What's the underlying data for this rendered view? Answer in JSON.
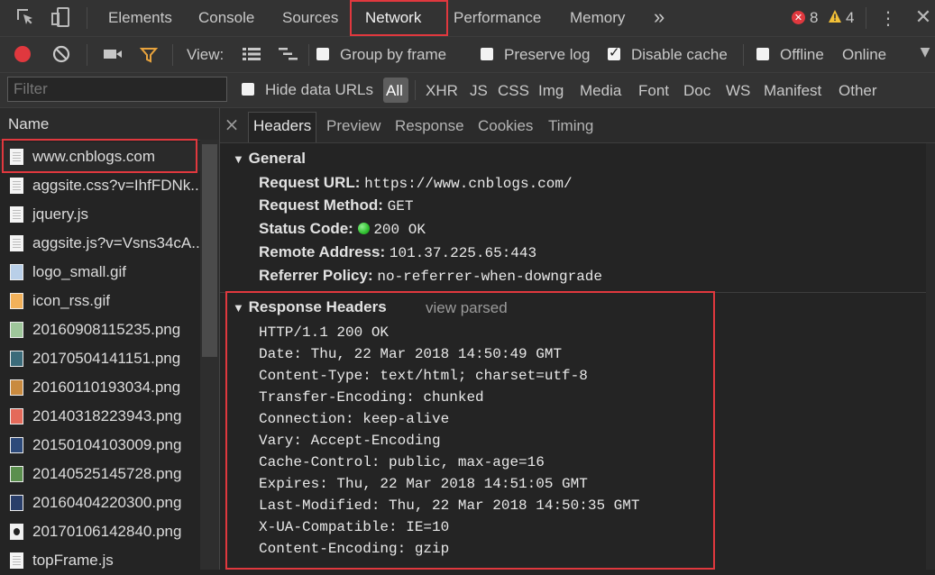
{
  "toolbar": {
    "tabs": [
      "Elements",
      "Console",
      "Sources",
      "Network",
      "Performance",
      "Memory"
    ],
    "more": "»",
    "error_count": "8",
    "warning_count": "4"
  },
  "netbar": {
    "view_label": "View:",
    "group_by_frame": "Group by frame",
    "preserve_log": "Preserve log",
    "disable_cache": "Disable cache",
    "offline": "Offline",
    "online": "Online"
  },
  "filterbar": {
    "filter_placeholder": "Filter",
    "hide_data_urls": "Hide data URLs",
    "types": [
      "All",
      "XHR",
      "JS",
      "CSS",
      "Img",
      "Media",
      "Font",
      "Doc",
      "WS",
      "Manifest",
      "Other"
    ]
  },
  "requests": {
    "header": "Name",
    "items": [
      "www.cnblogs.com",
      "aggsite.css?v=IhfFDNk..",
      "jquery.js",
      "aggsite.js?v=Vsns34cA..",
      "logo_small.gif",
      "icon_rss.gif",
      "20160908115235.png",
      "20170504141151.png",
      "20160110193034.png",
      "20140318223943.png",
      "20150104103009.png",
      "20140525145728.png",
      "20160404220300.png",
      "20170106142840.png",
      "topFrame.js"
    ]
  },
  "detail": {
    "close": "×",
    "tabs": [
      "Headers",
      "Preview",
      "Response",
      "Cookies",
      "Timing"
    ],
    "general": {
      "title": "General",
      "request_url_label": "Request URL:",
      "request_url": "https://www.cnblogs.com/",
      "request_method_label": "Request Method:",
      "request_method": "GET",
      "status_code_label": "Status Code:",
      "status_code": "200 OK",
      "remote_address_label": "Remote Address:",
      "remote_address": "101.37.225.65:443",
      "referrer_policy_label": "Referrer Policy:",
      "referrer_policy": "no-referrer-when-downgrade"
    },
    "response_headers": {
      "title": "Response Headers",
      "view_parsed": "view parsed",
      "lines": [
        "HTTP/1.1 200 OK",
        "Date: Thu, 22 Mar 2018 14:50:49 GMT",
        "Content-Type: text/html; charset=utf-8",
        "Transfer-Encoding: chunked",
        "Connection: keep-alive",
        "Vary: Accept-Encoding",
        "Cache-Control: public, max-age=16",
        "Expires: Thu, 22 Mar 2018 14:51:05 GMT",
        "Last-Modified: Thu, 22 Mar 2018 14:50:35 GMT",
        "X-UA-Compatible: IE=10",
        "Content-Encoding: gzip"
      ]
    }
  },
  "colors": {
    "highlight_box": "#e0383e",
    "record": "#e0383e",
    "filter_active": "#e8a33d",
    "status_ok": "#2fbf2f"
  }
}
